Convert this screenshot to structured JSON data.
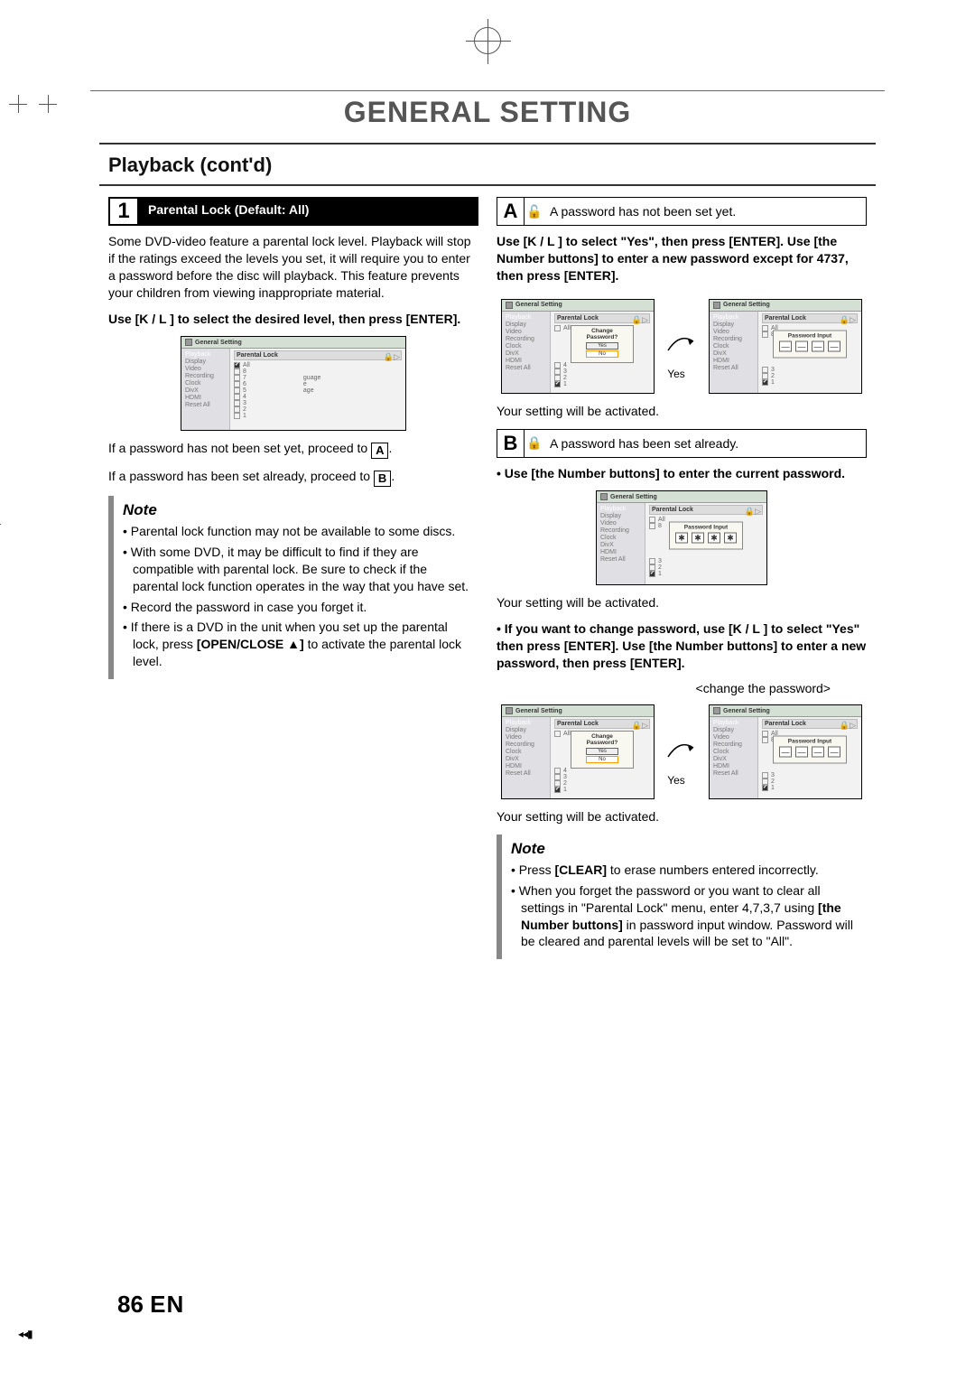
{
  "page": {
    "title": "GENERAL SETTING",
    "section": "Playback (cont'd)",
    "page_number": "86",
    "page_lang": "EN"
  },
  "step1": {
    "num": "1",
    "label": "Parental Lock (Default: All)",
    "intro": "Some DVD-video feature a parental lock level. Playback will stop if the ratings exceed the levels you set, it will require you to enter a password before the disc will playback. This feature prevents your children from viewing inappropriate material.",
    "instruct": "Use [K / L ] to select the desired level, then press [ENTER].",
    "line_a": "If a password has not been set yet, proceed to ",
    "line_a_box": "A",
    "line_b": "If a password has been set already, proceed to ",
    "line_b_box": "B"
  },
  "note1": {
    "title": "Note",
    "items": [
      "Parental lock function may not be available to some discs.",
      "With some DVD, it may be difficult to find if they are compatible with parental lock. Be sure to check if the parental lock function operates in the way that you have set.",
      "Record the password in case you forget it.",
      "If there is a DVD in the unit when you set up the parental lock, press [OPEN/CLOSE ▲] to activate the parental lock level."
    ]
  },
  "boxA": {
    "letter": "A",
    "text": "A password has not been set yet.",
    "instruct": "Use [K / L ] to select \"Yes\", then press [ENTER]. Use [the Number buttons] to enter a new password except for 4737, then press [ENTER].",
    "arrow_label": "Yes",
    "after": "Your setting will be activated."
  },
  "boxB": {
    "letter": "B",
    "text": "A password has been set already.",
    "instruct1": "Use [the Number buttons] to enter the current password.",
    "after1": "Your setting will be activated.",
    "instruct2": "If you want to change password, use [K / L ] to select \"Yes\" then press [ENTER]. Use [the Number buttons] to enter a new password, then press [ENTER].",
    "caption": "<change the password>",
    "arrow_label": "Yes",
    "after2": "Your setting will be activated."
  },
  "note2": {
    "title": "Note",
    "items": [
      "Press [CLEAR] to erase numbers entered incorrectly.",
      "When you forget the password or you want to clear all settings in \"Parental Lock\" menu, enter 4,7,3,7 using [the Number buttons] in password input window. Password will be cleared and parental levels will be set to \"All\"."
    ]
  },
  "screenshot": {
    "header": "General Setting",
    "sidebar": [
      "Playback",
      "Display",
      "Video",
      "Recording",
      "Clock",
      "DivX",
      "HDMI",
      "Reset All"
    ],
    "panel_title": "Parental Lock",
    "levels": [
      "All",
      "8",
      "7",
      "6",
      "5",
      "4",
      "3",
      "2",
      "1"
    ],
    "tags": [
      "",
      "",
      "guage",
      "e",
      "age",
      "",
      "",
      "",
      ""
    ],
    "levels_short": [
      "All",
      "8"
    ],
    "list_after_dialog": [
      "4",
      "3",
      "2",
      "1"
    ],
    "list_after_dialog2": [
      "3",
      "2",
      "1"
    ],
    "dialog_change": "Change Password?",
    "dialog_yes": "Yes",
    "dialog_no": "No",
    "dialog_input": "Password Input",
    "star": "✱",
    "dash": "—"
  }
}
